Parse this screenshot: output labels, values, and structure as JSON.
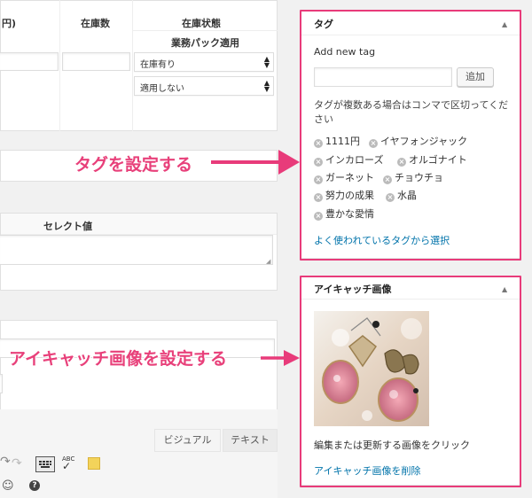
{
  "left_panel": {
    "headers": {
      "price_fragment": "円)",
      "stock_count": "在庫数",
      "stock_status": "在庫状態",
      "business_pack": "業務パック適用"
    },
    "selects": {
      "stock_status_value": "在庫有り",
      "business_pack_value": "適用しない"
    },
    "select_value_header": "セレクト値",
    "editor_tabs": {
      "visual": "ビジュアル",
      "text": "テキスト"
    }
  },
  "tag_box": {
    "title": "タグ",
    "add_new_label": "Add new tag",
    "add_button": "追加",
    "hint": "タグが複数ある場合はコンマで区切ってください",
    "tags": [
      "1111円",
      "イヤフォンジャック",
      "インカローズ",
      "オルゴナイト",
      "ガーネット",
      "チョウチョ",
      "努力の成果",
      "水晶",
      "豊かな愛情"
    ],
    "popular_link": "よく使われているタグから選択"
  },
  "featured_box": {
    "title": "アイキャッチ画像",
    "edit_hint": "編集または更新する画像をクリック",
    "remove_link": "アイキャッチ画像を削除"
  },
  "annotations": {
    "tag_callout": "タグを設定する",
    "featured_callout": "アイキャッチ画像を設定する"
  },
  "colors": {
    "highlight": "#e83b7a",
    "link": "#0073aa",
    "callout": "#e8407a"
  }
}
